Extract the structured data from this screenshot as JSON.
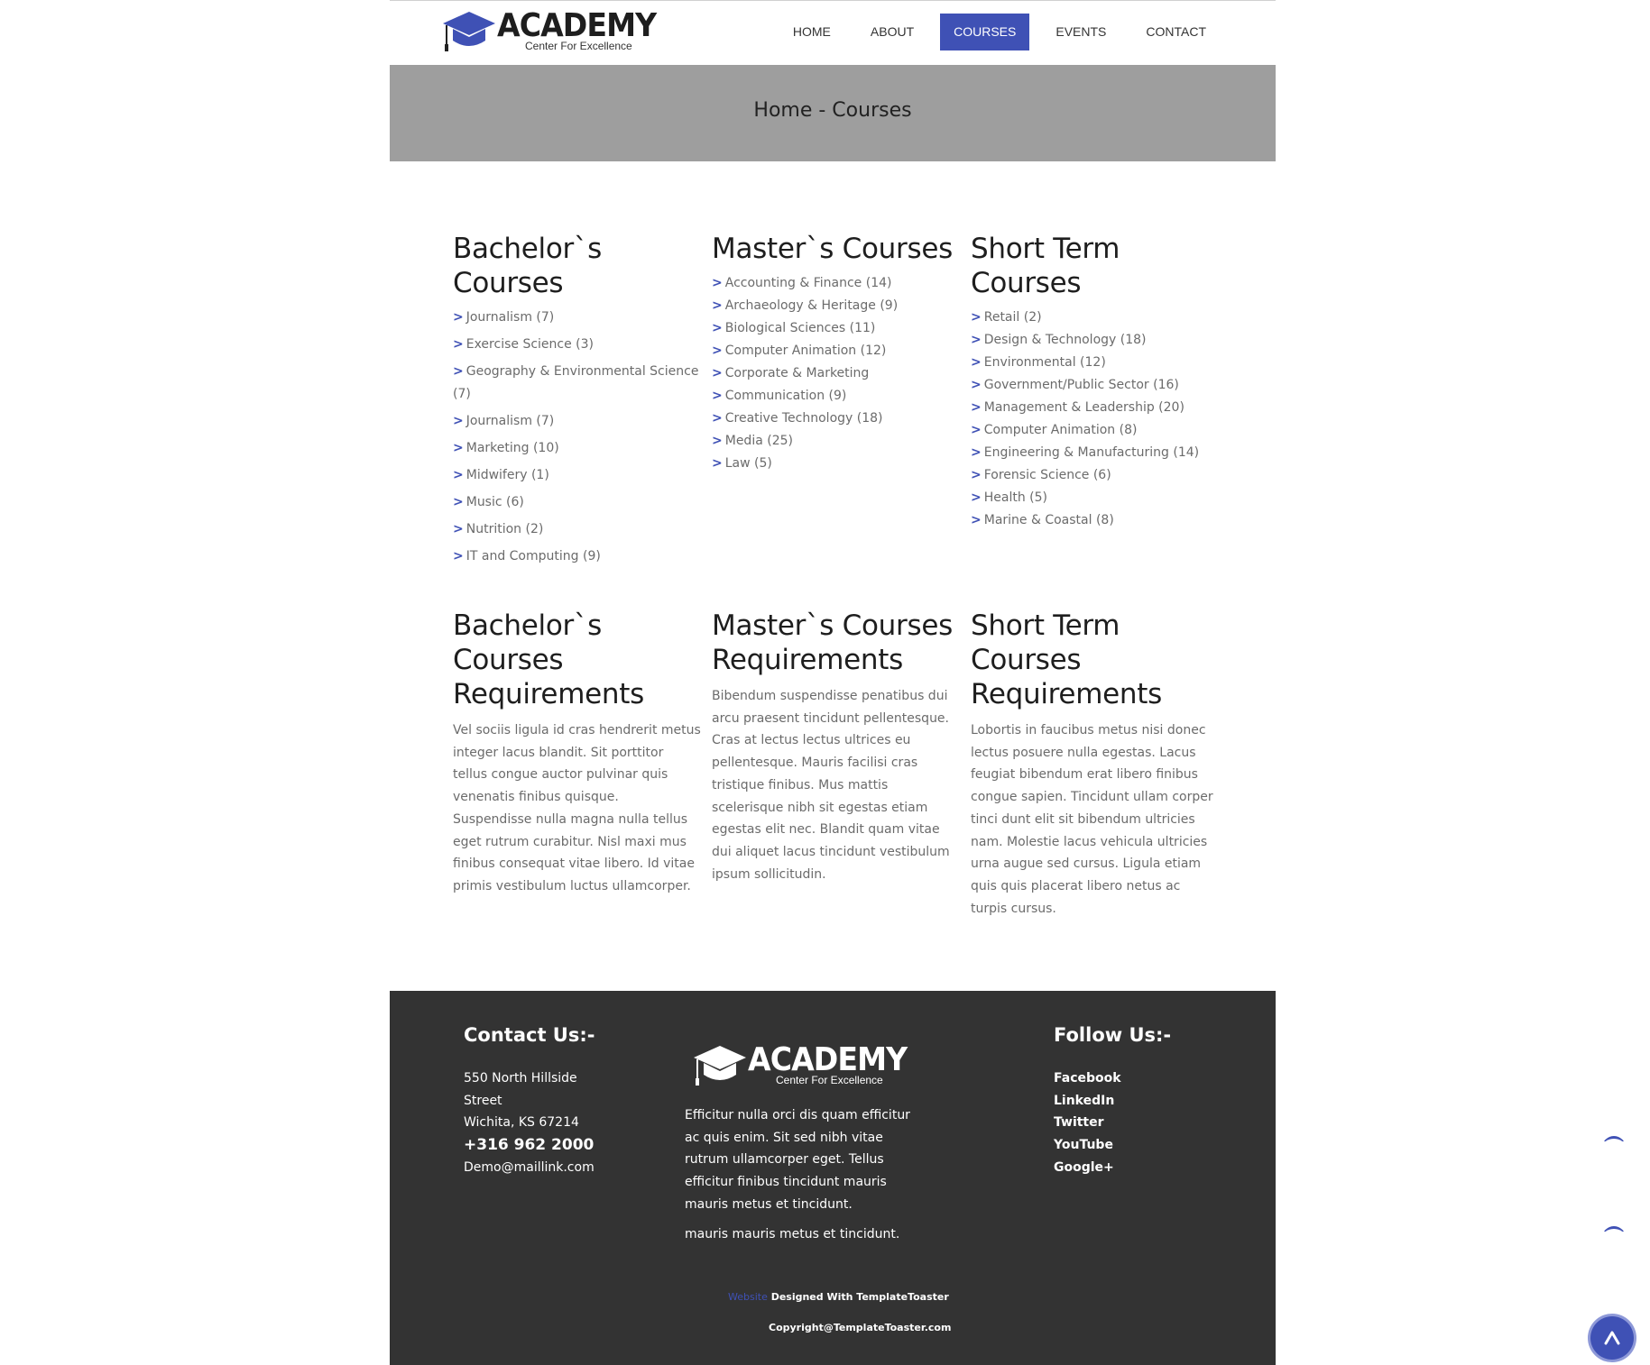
{
  "header": {
    "logo_title": "ACADEMY",
    "logo_subtitle": "Center For Excellence",
    "nav": [
      {
        "label": "HOME"
      },
      {
        "label": "ABOUT"
      },
      {
        "label": "COURSES",
        "active": true
      },
      {
        "label": "EVENTS"
      },
      {
        "label": "CONTACT"
      }
    ]
  },
  "banner": {
    "title": "Home - Courses"
  },
  "courses": {
    "bachelor": {
      "heading": "Bachelor`s Courses",
      "items": [
        "Journalism (7)",
        "Exercise Science (3)",
        "Geography & Environmental Science (7)",
        "Journalism (7)",
        "Marketing (10)",
        "Midwifery (1)",
        "Music (6)",
        "Nutrition (2)",
        "IT and Computing (9)"
      ]
    },
    "master": {
      "heading": "Master`s Courses",
      "items": [
        "Accounting & Finance (14)",
        "Archaeology & Heritage (9)",
        "Biological Sciences (11)",
        "Computer Animation (12)",
        "Corporate & Marketing",
        "Communication (9)",
        "Creative Technology (18)",
        "Media (25)",
        "Law (5)"
      ]
    },
    "short": {
      "heading": "Short Term Courses",
      "items": [
        "Retail (2)",
        "Design & Technology (18)",
        "Environmental (12)",
        "Government/Public Sector (16)",
        "Management & Leadership (20)",
        "Computer Animation (8)",
        "Engineering & Manufacturing (14)",
        "Forensic Science (6)",
        "Health (5)",
        "Marine & Coastal (8)"
      ]
    }
  },
  "requirements": {
    "bachelor": {
      "heading": "Bachelor`s Courses Requirements",
      "text": "Vel sociis ligula id cras hendrerit metus integer lacus blandit. Sit porttitor tellus congue auctor pulvinar quis venenatis finibus quisque. Suspendisse nulla magna nulla tellus eget rutrum curabitur. Nisl maxi mus finibus consequat vitae libero. Id vitae primis vestibulum luctus ullamcorper."
    },
    "master": {
      "heading": "Master`s Courses Requirements",
      "text": "Bibendum suspendisse penatibus dui arcu praesent tincidunt pellentesque. Cras at lectus lectus ultrices eu pellentesque. Mauris facilisi cras tristique finibus. Mus mattis scelerisque nibh sit egestas etiam egestas elit nec. Blandit quam vitae dui aliquet lacus tincidunt vestibulum ipsum sollicitudin."
    },
    "short": {
      "heading": "Short Term Courses Requirements",
      "text": "Lobortis in faucibus metus nisi donec lectus posuere nulla egestas. Lacus feugiat bibendum erat libero finibus congue sapien. Tincidunt ullam corper tinci dunt elit sit bibendum ultricies nam. Molestie lacus vehicula ultricies urna augue sed cursus. Ligula etiam quis quis placerat libero netus ac turpis cursus."
    }
  },
  "footer": {
    "contact_heading": "Contact Us:-",
    "address_line1": "550 North Hillside",
    "address_line2": "Street",
    "address_line3": "Wichita, KS 67214",
    "phone": "+316 962 2000",
    "email": "Demo@maillink.com",
    "logo_title": "ACADEMY",
    "logo_subtitle": "Center For Excellence",
    "about_text": "Efficitur nulla orci dis quam efficitur ac quis enim. Sit sed nibh vitae rutrum ullamcorper eget. Tellus efficitur  finibus tincidunt mauris mauris metus et tincidunt.",
    "about_text_repeat": "mauris mauris metus et tincidunt.",
    "follow_heading": "Follow Us:-",
    "social": [
      "Facebook",
      "LinkedIn",
      "Twitter",
      "YouTube",
      "Google+"
    ],
    "credit_link": "Website",
    "credit_text": " Designed With TemplateToaster",
    "copyright": "Copyright@TemplateToaster.com"
  },
  "colors": {
    "accent": "#3f51b5",
    "banner": "#9e9e9e",
    "footer": "#333333"
  },
  "icons": {
    "logo": "graduation-cap-icon",
    "scroll_top": "chevron-up-icon"
  }
}
